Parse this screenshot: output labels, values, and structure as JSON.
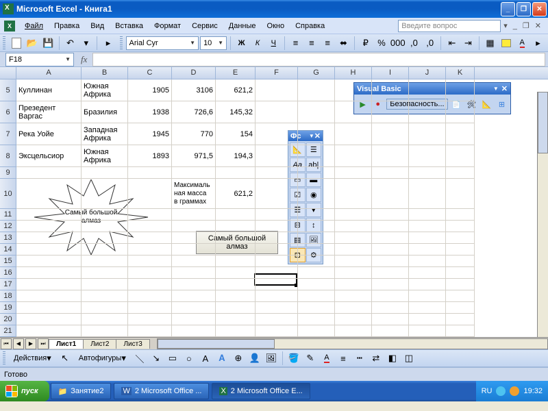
{
  "title": "Microsoft Excel - Книга1",
  "menu": [
    "Файл",
    "Правка",
    "Вид",
    "Вставка",
    "Формат",
    "Сервис",
    "Данные",
    "Окно",
    "Справка"
  ],
  "question_placeholder": "Введите вопрос",
  "font": {
    "name": "Arial Cyr",
    "size": "10"
  },
  "namebox": "F18",
  "columns": [
    "A",
    "B",
    "C",
    "D",
    "E",
    "F",
    "G",
    "H",
    "I",
    "J",
    "K"
  ],
  "rows": {
    "5": {
      "A": "Куллинан",
      "B": "Южная Африка",
      "C": "1905",
      "D": "3106",
      "E": "621,2"
    },
    "6": {
      "A": "Презедент Варгас",
      "B": "Бразилия",
      "C": "1938",
      "D": "726,6",
      "E": "145,32"
    },
    "7": {
      "A": "Река Уойе",
      "B": "Западная Африка",
      "C": "1945",
      "D": "770",
      "E": "154"
    },
    "8": {
      "A": "Эксцельсиор",
      "B": "Южная Африка",
      "C": "1893",
      "D": "971,5",
      "E": "194,3"
    },
    "10": {
      "D": "Максималь\nная масса\nв граммах",
      "E": "621,2"
    }
  },
  "starburst_text": "Самый большой алмаз",
  "form_button_text": "Самый большой алмаз",
  "vb_toolbar": {
    "title": "Visual Basic",
    "security": "Безопасность..."
  },
  "toolbox_title": "Фс",
  "sheet_tabs": [
    "Лист1",
    "Лист2",
    "Лист3"
  ],
  "active_sheet": "Лист1",
  "draw_labels": {
    "actions": "Действия",
    "autoshapes": "Автофигуры"
  },
  "status": "Готово",
  "taskbar": {
    "start": "пуск",
    "items": [
      {
        "label": "Занятие2",
        "icon": "folder"
      },
      {
        "label": "2 Microsoft Office ...",
        "icon": "word",
        "count": "2"
      },
      {
        "label": "2 Microsoft Office E...",
        "icon": "excel",
        "count": "2"
      }
    ],
    "lang": "RU",
    "time": "19:32"
  }
}
